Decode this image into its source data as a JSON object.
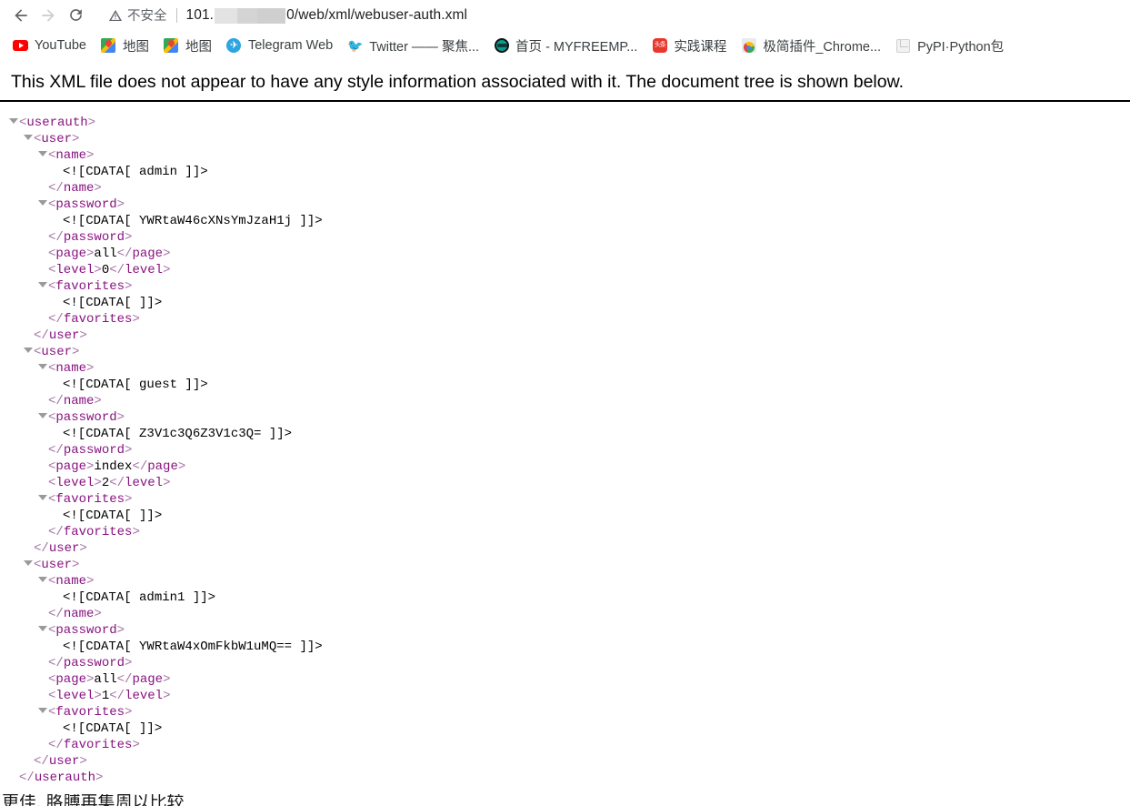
{
  "browser": {
    "back_icon": "back-arrow-icon",
    "forward_icon": "forward-arrow-icon",
    "reload_icon": "reload-icon",
    "security": {
      "icon": "warning-triangle-icon",
      "label": "不安全"
    },
    "url": {
      "prefix": "101.",
      "redacted": true,
      "suffix": "0/web/xml/webuser-auth.xml"
    },
    "bookmarks": [
      {
        "icon": "youtube-icon",
        "label": "YouTube"
      },
      {
        "icon": "google-maps-icon",
        "label": "地图"
      },
      {
        "icon": "google-maps-icon",
        "label": "地图"
      },
      {
        "icon": "telegram-icon",
        "label": "Telegram Web"
      },
      {
        "icon": "twitter-icon",
        "label": "Twitter —— 聚焦..."
      },
      {
        "icon": "globe-icon",
        "label": "首页 - MYFREEMP..."
      },
      {
        "icon": "toutiao-icon",
        "label": "实践课程"
      },
      {
        "icon": "chrome-store-icon",
        "label": "极简插件_Chrome..."
      },
      {
        "icon": "pypi-icon",
        "label": "PyPI·Python包"
      }
    ]
  },
  "page": {
    "style_notice": "This XML file does not appear to have any style information associated with it. The document tree is shown below.",
    "bottom_partial_text": "更佳, 胳膊再集周以比较"
  },
  "xml": {
    "root_tag": "userauth",
    "lines": [
      {
        "indent": 0,
        "toggle": true,
        "type": "open",
        "tag": "userauth"
      },
      {
        "indent": 1,
        "toggle": true,
        "type": "open",
        "tag": "user"
      },
      {
        "indent": 2,
        "toggle": true,
        "type": "open",
        "tag": "name"
      },
      {
        "indent": 3,
        "toggle": false,
        "type": "cdata",
        "value": " admin "
      },
      {
        "indent": 2,
        "toggle": false,
        "type": "close",
        "tag": "name"
      },
      {
        "indent": 2,
        "toggle": true,
        "type": "open",
        "tag": "password"
      },
      {
        "indent": 3,
        "toggle": false,
        "type": "cdata",
        "value": " YWRtaW46cXNsYmJzaH1j "
      },
      {
        "indent": 2,
        "toggle": false,
        "type": "close",
        "tag": "password"
      },
      {
        "indent": 2,
        "toggle": false,
        "type": "inline",
        "tag": "page",
        "value": "all"
      },
      {
        "indent": 2,
        "toggle": false,
        "type": "inline",
        "tag": "level",
        "value": "0"
      },
      {
        "indent": 2,
        "toggle": true,
        "type": "open",
        "tag": "favorites"
      },
      {
        "indent": 3,
        "toggle": false,
        "type": "cdata",
        "value": " "
      },
      {
        "indent": 2,
        "toggle": false,
        "type": "close",
        "tag": "favorites"
      },
      {
        "indent": 1,
        "toggle": false,
        "type": "close",
        "tag": "user"
      },
      {
        "indent": 1,
        "toggle": true,
        "type": "open",
        "tag": "user"
      },
      {
        "indent": 2,
        "toggle": true,
        "type": "open",
        "tag": "name"
      },
      {
        "indent": 3,
        "toggle": false,
        "type": "cdata",
        "value": " guest "
      },
      {
        "indent": 2,
        "toggle": false,
        "type": "close",
        "tag": "name"
      },
      {
        "indent": 2,
        "toggle": true,
        "type": "open",
        "tag": "password"
      },
      {
        "indent": 3,
        "toggle": false,
        "type": "cdata",
        "value": " Z3V1c3Q6Z3V1c3Q= "
      },
      {
        "indent": 2,
        "toggle": false,
        "type": "close",
        "tag": "password"
      },
      {
        "indent": 2,
        "toggle": false,
        "type": "inline",
        "tag": "page",
        "value": "index"
      },
      {
        "indent": 2,
        "toggle": false,
        "type": "inline",
        "tag": "level",
        "value": "2"
      },
      {
        "indent": 2,
        "toggle": true,
        "type": "open",
        "tag": "favorites"
      },
      {
        "indent": 3,
        "toggle": false,
        "type": "cdata",
        "value": " "
      },
      {
        "indent": 2,
        "toggle": false,
        "type": "close",
        "tag": "favorites"
      },
      {
        "indent": 1,
        "toggle": false,
        "type": "close",
        "tag": "user"
      },
      {
        "indent": 1,
        "toggle": true,
        "type": "open",
        "tag": "user"
      },
      {
        "indent": 2,
        "toggle": true,
        "type": "open",
        "tag": "name"
      },
      {
        "indent": 3,
        "toggle": false,
        "type": "cdata",
        "value": " admin1 "
      },
      {
        "indent": 2,
        "toggle": false,
        "type": "close",
        "tag": "name"
      },
      {
        "indent": 2,
        "toggle": true,
        "type": "open",
        "tag": "password"
      },
      {
        "indent": 3,
        "toggle": false,
        "type": "cdata",
        "value": " YWRtaW4xOmFkbW1uMQ== "
      },
      {
        "indent": 2,
        "toggle": false,
        "type": "close",
        "tag": "password"
      },
      {
        "indent": 2,
        "toggle": false,
        "type": "inline",
        "tag": "page",
        "value": "all"
      },
      {
        "indent": 2,
        "toggle": false,
        "type": "inline",
        "tag": "level",
        "value": "1"
      },
      {
        "indent": 2,
        "toggle": true,
        "type": "open",
        "tag": "favorites"
      },
      {
        "indent": 3,
        "toggle": false,
        "type": "cdata",
        "value": " "
      },
      {
        "indent": 2,
        "toggle": false,
        "type": "close",
        "tag": "favorites"
      },
      {
        "indent": 1,
        "toggle": false,
        "type": "close",
        "tag": "user"
      },
      {
        "indent": 0,
        "toggle": false,
        "type": "close",
        "tag": "userauth"
      }
    ]
  },
  "colors": {
    "tag": "#881280",
    "bracket": "#a371a3",
    "text": "#000000",
    "triangle": "#9a9a9a",
    "omnibox_bg": "#f1f3f4",
    "security_text": "#5f6368"
  }
}
